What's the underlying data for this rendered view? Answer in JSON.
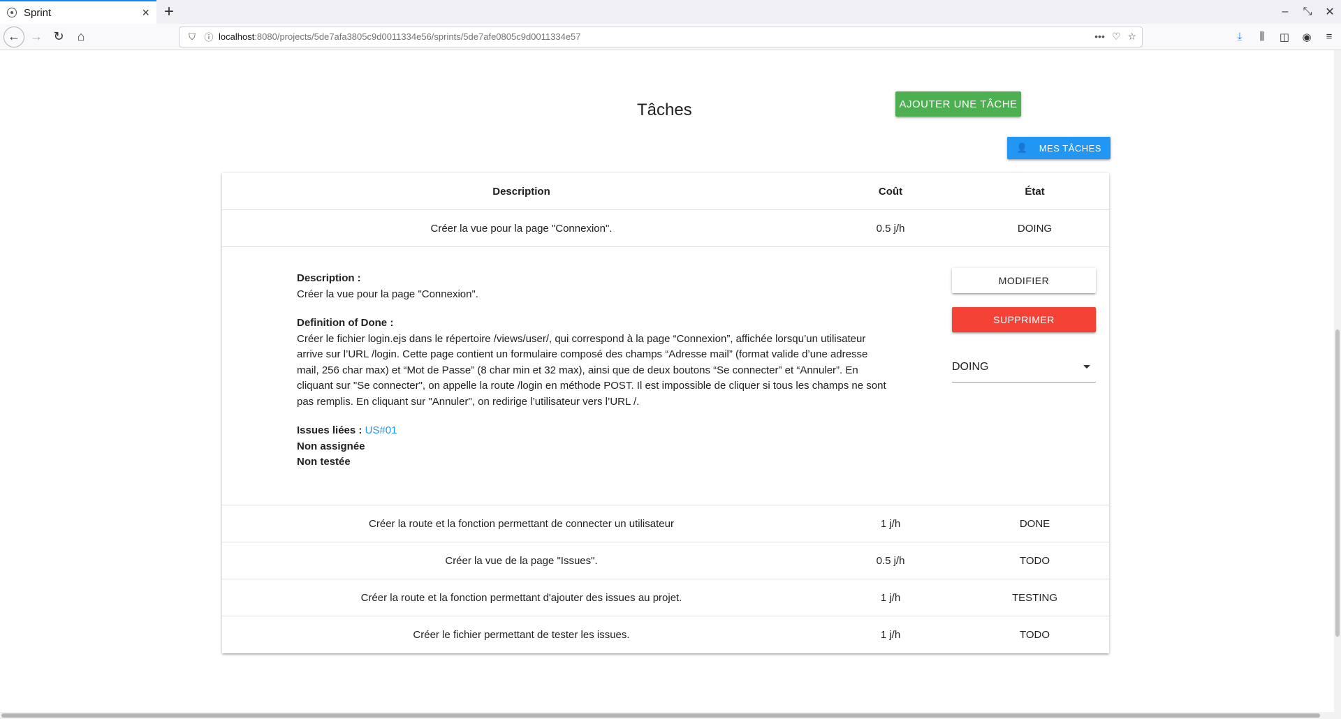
{
  "browser": {
    "tab_title": "Sprint",
    "url_host": "localhost",
    "url_path": ":8080/projects/5de7afa3805c9d0011334e56/sprints/5de7afe0805c9d0011334e57"
  },
  "header": {
    "title": "Tâches",
    "add_button": "AJOUTER UNE TÂCHE",
    "my_tasks_button": "MES TÂCHES"
  },
  "table": {
    "columns": {
      "description": "Description",
      "cost": "Coût",
      "state": "État"
    },
    "rows": [
      {
        "description": "Créer la vue pour la page \"Connexion\".",
        "cost": "0.5 j/h",
        "state": "DOING"
      },
      {
        "description": "Créer la route et la fonction permettant de connecter un utilisateur",
        "cost": "1 j/h",
        "state": "DONE"
      },
      {
        "description": "Créer la vue de la page \"Issues\".",
        "cost": "0.5 j/h",
        "state": "TODO"
      },
      {
        "description": "Créer la route et la fonction permettant d'ajouter des issues au projet.",
        "cost": "1 j/h",
        "state": "TESTING"
      },
      {
        "description": "Créer le fichier permettant de tester les issues.",
        "cost": "1 j/h",
        "state": "TODO"
      }
    ]
  },
  "detail": {
    "description_label": "Description :",
    "description_text": "Créer la vue pour la page \"Connexion\".",
    "dod_label": "Definition of Done :",
    "dod_lines": [
      "Créer le fichier login.ejs dans le répertoire /views/user/, qui correspond à la page “Connexion”, affichée lorsqu’un utilisateur",
      "arrive sur l’URL /login. Cette page contient un formulaire composé des champs “Adresse mail” (format valide d’une adresse",
      "mail, 256 char max) et “Mot de Passe” (8 char min et 32 max), ainsi que de deux boutons “Se connecter” et “Annuler”. En",
      "cliquant sur \"Se connecter\", on appelle la route /login en méthode POST. Il est impossible de cliquer si tous les champs ne sont",
      "pas remplis. En cliquant sur \"Annuler\", on redirige l’utilisateur vers l’URL /."
    ],
    "issues_label": "Issues liées :",
    "issue_link": "US#01",
    "assigned": "Non assignée",
    "tested": "Non testée",
    "edit_button": "MODIFIER",
    "delete_button": "SUPPRIMER",
    "state_value": "DOING"
  },
  "colors": {
    "add": "#4caf50",
    "mine": "#2196f3",
    "delete": "#f44336",
    "link": "#2196f3"
  }
}
